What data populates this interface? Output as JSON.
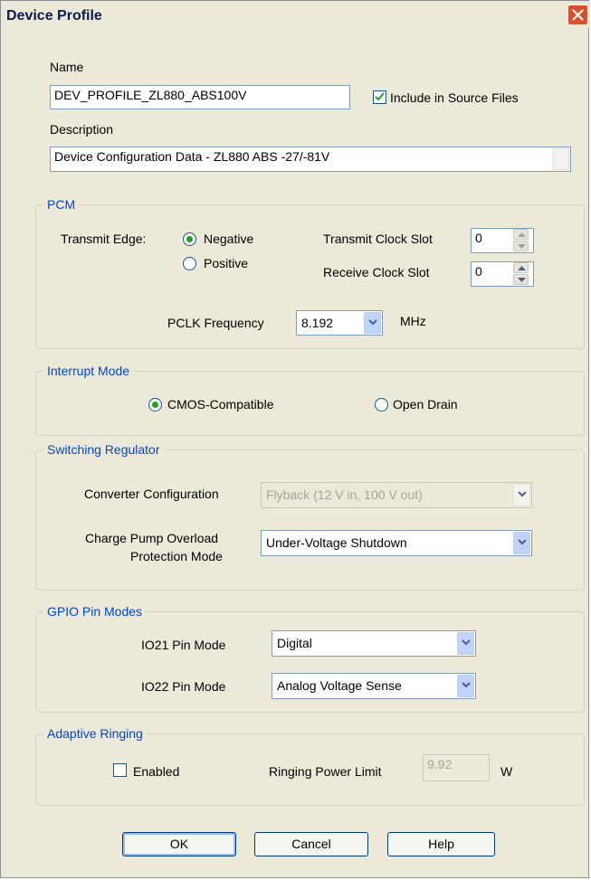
{
  "window": {
    "title": "Device Profile"
  },
  "name": {
    "label": "Name",
    "value": "DEV_PROFILE_ZL880_ABS100V"
  },
  "include_source": {
    "label": "Include in Source Files",
    "checked": true
  },
  "description": {
    "label": "Description",
    "value": "Device Configuration Data - ZL880 ABS -27/-81V"
  },
  "pcm": {
    "title": "PCM",
    "transmit_edge_label": "Transmit Edge:",
    "negative_label": "Negative",
    "positive_label": "Positive",
    "transmit_slot_label": "Transmit Clock Slot",
    "transmit_slot_value": "0",
    "receive_slot_label": "Receive Clock Slot",
    "receive_slot_value": "0",
    "pclk_label": "PCLK Frequency",
    "pclk_value": "8.192",
    "pclk_unit": "MHz"
  },
  "interrupt": {
    "title": "Interrupt Mode",
    "cmos_label": "CMOS-Compatible",
    "open_drain_label": "Open Drain"
  },
  "switching": {
    "title": "Switching Regulator",
    "converter_label": "Converter Configuration",
    "converter_value": "Flyback (12 V in, 100 V out)",
    "charge_pump_label_1": "Charge Pump Overload",
    "charge_pump_label_2": "Protection Mode",
    "charge_pump_value": "Under-Voltage Shutdown"
  },
  "gpio": {
    "title": "GPIO Pin Modes",
    "io21_label": "IO21 Pin Mode",
    "io21_value": "Digital",
    "io22_label": "IO22 Pin Mode",
    "io22_value": "Analog Voltage Sense"
  },
  "adaptive": {
    "title": "Adaptive Ringing",
    "enabled_label": "Enabled",
    "power_limit_label": "Ringing Power Limit",
    "power_limit_value": "9.92",
    "unit": "W"
  },
  "buttons": {
    "ok": "OK",
    "cancel": "Cancel",
    "help": "Help"
  },
  "colors": {
    "accent": "#0046d5",
    "radio_selected": "#21a121",
    "close": "#d7512f",
    "face": "#ece9d8"
  }
}
